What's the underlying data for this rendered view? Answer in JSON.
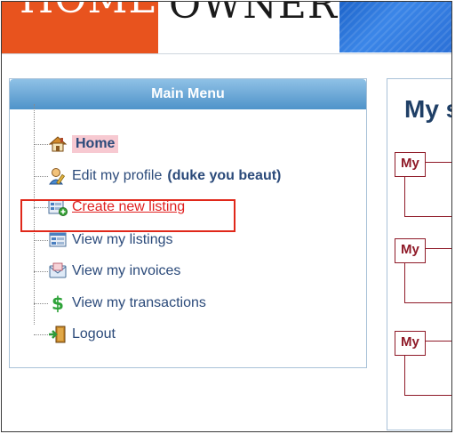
{
  "banner": {
    "logo_home": "HOME",
    "logo_owner": "OWNER"
  },
  "menu": {
    "title": "Main Menu",
    "items": [
      {
        "label": "Home",
        "icon": "home-icon"
      },
      {
        "label": "Edit my profile",
        "suffix": "(duke you beaut)",
        "icon": "profile-edit-icon"
      },
      {
        "label": "Create new listing",
        "icon": "new-listing-icon"
      },
      {
        "label": "View my listings",
        "icon": "listings-icon"
      },
      {
        "label": "View my invoices",
        "icon": "invoice-icon"
      },
      {
        "label": "View my transactions",
        "icon": "dollar-icon"
      },
      {
        "label": "Logout",
        "icon": "logout-door-icon"
      }
    ]
  },
  "main": {
    "title": "My s",
    "boxes": [
      "My",
      "My",
      "My"
    ]
  },
  "colors": {
    "banner_orange": "#e8531e",
    "banner_blue": "#2a6fd6",
    "menu_header": "#4f93c9",
    "highlight_red": "#e0281a",
    "box_border": "#8f1a28"
  }
}
